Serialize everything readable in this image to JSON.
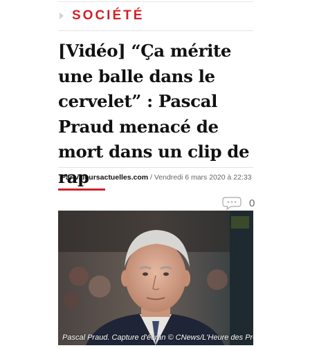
{
  "section": {
    "label": "SOCIÉTÉ",
    "icon": "chevron-right-icon"
  },
  "article": {
    "title": "[Vidéo] “Ça mérite une balle dans le cervelet” : Pascal Praud menacé de mort dans un clip de rap",
    "byline_prefix": "Par",
    "author": "valeursactuelles.com",
    "date": " / Vendredi 6 mars 2020 à 22:33",
    "comment_count": "0",
    "image_caption": "Pascal Praud. Capture d'écran © CNews/L'Heure des Pros"
  },
  "colors": {
    "accent": "#d21f26"
  }
}
